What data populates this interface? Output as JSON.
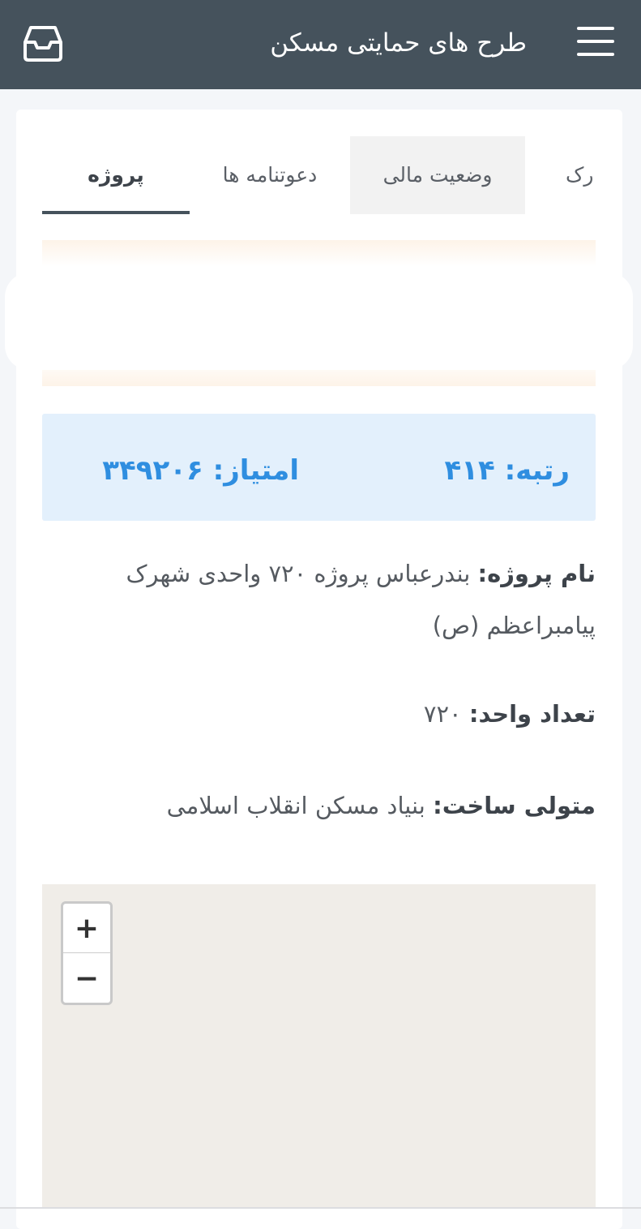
{
  "header": {
    "title": "طرح های حمایتی مسکن",
    "left_icon": "inbox-icon",
    "right_icon": "hamburger-menu-icon"
  },
  "tabs": [
    {
      "label": "پروژه",
      "active": true
    },
    {
      "label": "دعوتنامه ها",
      "active": false
    },
    {
      "label": "وضعیت مالی",
      "active": false
    },
    {
      "label": "رک",
      "active": false
    }
  ],
  "score": {
    "rank_label": "رتبه:",
    "rank_value": "۴۱۴",
    "points_label": "امتیاز:",
    "points_value": "۳۴۹۲۰۶"
  },
  "project": {
    "name_label": "نام پروژه:",
    "name_value": "بندرعباس پروژه ۷۲۰ واحدی شهرک پیامبراعظم (ص)",
    "units_label": "تعداد واحد:",
    "units_value": "۷۲۰",
    "builder_label": "متولی ساخت:",
    "builder_value": "بنیاد مسکن انقلاب اسلامی"
  },
  "map": {
    "zoom_in": "+",
    "zoom_out": "−"
  },
  "colors": {
    "header_bg": "#45525c",
    "score_bg": "#e3f0fc",
    "score_text": "#2f8ee0"
  }
}
